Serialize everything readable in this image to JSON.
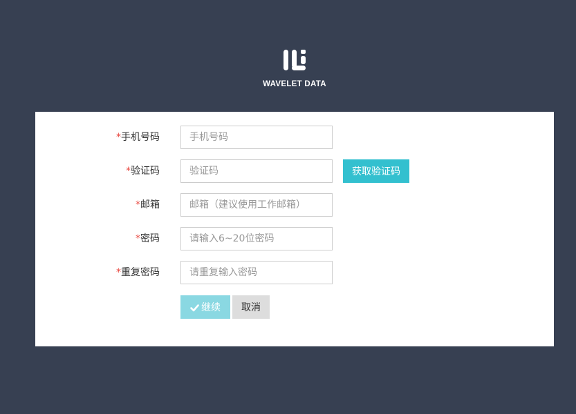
{
  "brand": {
    "name": "WAVELET DATA",
    "logo_icon": "wavelet-logo-icon"
  },
  "form": {
    "required_mark": "*",
    "fields": [
      {
        "label": "手机号码",
        "placeholder": "手机号码",
        "value": ""
      },
      {
        "label": "验证码",
        "placeholder": "验证码",
        "value": ""
      },
      {
        "label": "邮箱",
        "placeholder": "邮箱（建议使用工作邮箱）",
        "value": ""
      },
      {
        "label": "密码",
        "placeholder": "请输入6~20位密码",
        "value": ""
      },
      {
        "label": "重复密码",
        "placeholder": "请重复输入密码",
        "value": ""
      }
    ],
    "get_code_label": "获取验证码",
    "continue_label": "继续",
    "continue_icon": "check-icon",
    "cancel_label": "取消"
  },
  "colors": {
    "background": "#374052",
    "panel": "#ffffff",
    "accent": "#33c0cf",
    "accent_light": "#8ad8e2",
    "required": "#e9473f",
    "cancel_bg": "#dddddd"
  }
}
